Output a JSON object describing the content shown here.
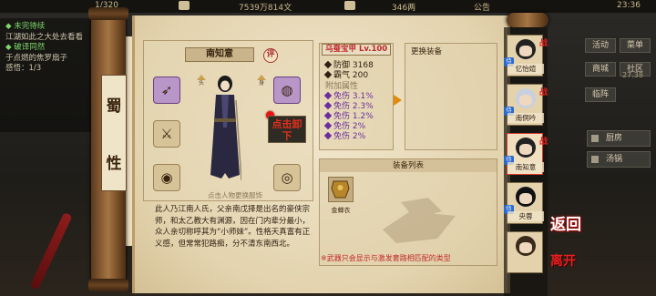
{
  "top_bar": {
    "bag_count": "1/320",
    "money": "7539万814文",
    "coins": "346两",
    "notice": "公告",
    "time": "23:36"
  },
  "quests": {
    "title1": "◆ 未完待续",
    "text1": "江湖如此之大处去看看",
    "title2": "◆ 破译同然",
    "text2": "于点燃的焦罗扇子",
    "progress": "感悟：1/3"
  },
  "right_menu": {
    "btn_activity": "活动",
    "btn_menu": "菜单",
    "btn_shop": "商城",
    "btn_social": "社区",
    "btn_battle": "临阵",
    "btn_kitchen": "厨房",
    "btn_bath": "汤锅",
    "counter": "27.38"
  },
  "faction": [
    "蜀",
    "性"
  ],
  "character": {
    "name": "南知意",
    "comment_label": "评",
    "unload_label": "点击卸下",
    "hint": "点击人物更换服饰",
    "bio": "此人乃江南人氏，父亲南戊择是出名的豪侠宗师，和太乙教大有渊源，因在门内辈分最小，众人亲切称呼其为“小师妹”。性格天真富有正义感，但常常犯路痴，分不清东南西北。",
    "slot_labels": [
      "头",
      "身"
    ]
  },
  "equipment": {
    "title": "乌蚕宝甲 Lv.100",
    "stats": [
      {
        "label": "防御",
        "value": "3168"
      },
      {
        "label": "霸气",
        "value": "200"
      }
    ],
    "extra_title": "附加属性",
    "extras": [
      {
        "label": "免伤",
        "value": "3.1%"
      },
      {
        "label": "免伤",
        "value": "2.3%"
      },
      {
        "label": "免伤",
        "value": "1.2%"
      },
      {
        "label": "免伤",
        "value": "2%"
      },
      {
        "label": "免伤",
        "value": "2%"
      }
    ]
  },
  "replace": {
    "title": "更换装备"
  },
  "equip_list": {
    "title": "装备列表",
    "items": [
      {
        "name": "金蝉衣"
      }
    ],
    "footnote": "※武器只会显示与激发套路相匹配的类型"
  },
  "party": [
    {
      "name": "忆怡媗",
      "tag": "侍",
      "active": false
    },
    {
      "name": "南侗吟",
      "tag": "侍",
      "active": false
    },
    {
      "name": "南知意",
      "tag": "侍",
      "active": true
    },
    {
      "name": "央蓉",
      "tag": "侍",
      "active": false
    },
    {
      "name": "",
      "tag": "",
      "active": false
    }
  ],
  "party_mark": "战",
  "back_label": "返回",
  "leave_label": "离开",
  "colors": {
    "accent_red": "#e32020",
    "paper": "#e9dcbc",
    "purple_stat": "#6a2ea0",
    "wood": "#8a5e34"
  }
}
